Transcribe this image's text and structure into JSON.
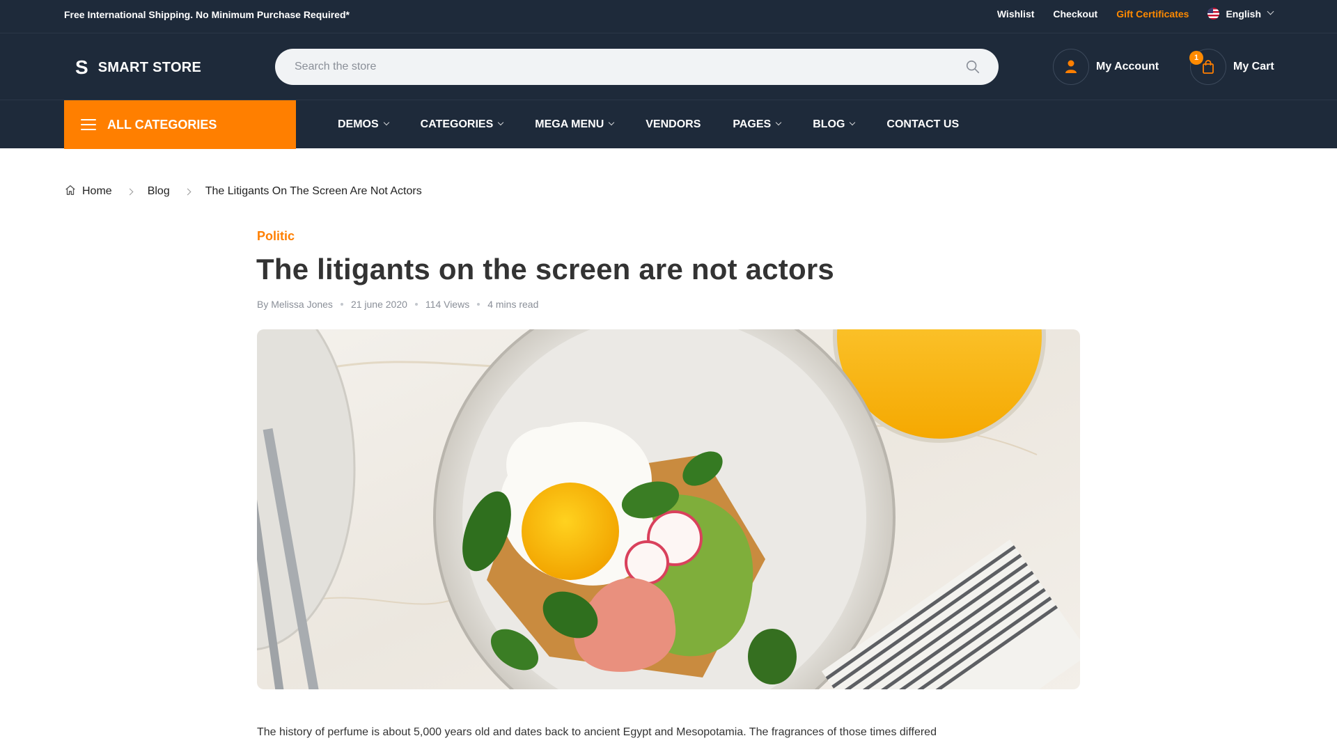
{
  "topbar": {
    "promo": "Free International Shipping. No Minimum Purchase Required*",
    "links": {
      "wishlist": "Wishlist",
      "checkout": "Checkout",
      "gift": "Gift Certificates",
      "language": "English"
    },
    "gift_color": "#ff8a00"
  },
  "header": {
    "logo_mark": "S",
    "logo_name": "SMART STORE",
    "search_placeholder": "Search the store",
    "account_label": "My Account",
    "cart_label": "My Cart",
    "cart_count": "1"
  },
  "nav": {
    "all_categories": "ALL CATEGORIES",
    "items": [
      "DEMOS",
      "CATEGORIES",
      "MEGA MENU",
      "VENDORS",
      "PAGES",
      "BLOG",
      "CONTACT US"
    ],
    "accent": "#ff7f00",
    "bg": "#1e2a3a"
  },
  "breadcrumb": {
    "home": "Home",
    "blog": "Blog",
    "current": "The Litigants On The Screen Are Not Actors"
  },
  "article": {
    "category": "Politic",
    "title": "The litigants on the screen are not actors",
    "author": "By Melissa Jones",
    "date": "21 june 2020",
    "views": "114 Views",
    "read_time": "4 mins read",
    "body_first_line": "The history of perfume is about 5,000 years old and dates back to ancient Egypt and Mesopotamia. The fragrances of those times differed"
  }
}
